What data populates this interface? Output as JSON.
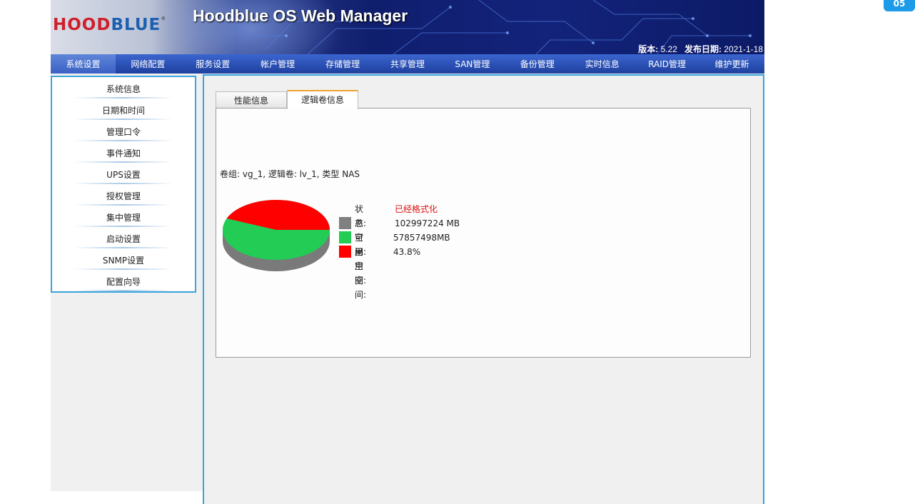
{
  "header": {
    "logo_left": "HOOD",
    "logo_right": "BLUE",
    "title": "Hoodblue OS Web Manager",
    "version_label": "版本:",
    "version": "5.22",
    "release_label": "发布日期:",
    "release_date": "2021-1-18"
  },
  "nav": {
    "items": [
      "系统设置",
      "网络配置",
      "服务设置",
      "帐户管理",
      "存储管理",
      "共享管理",
      "SAN管理",
      "备份管理",
      "实时信息",
      "RAID管理",
      "维护更新"
    ],
    "active": "系统设置"
  },
  "sidebar": {
    "items": [
      "系统信息",
      "日期和时间",
      "管理口令",
      "事件通知",
      "UPS设置",
      "授权管理",
      "集中管理",
      "启动设置",
      "SNMP设置",
      "配置向导"
    ]
  },
  "tabs": {
    "perf": "性能信息",
    "lv": "逻辑卷信息",
    "active": "逻辑卷信息"
  },
  "volume": {
    "info": "卷组: vg_1, 逻辑卷: lv_1, 类型 NAS",
    "status_label": "状态:",
    "status_value": "已经格式化",
    "total_label": "总空间:",
    "total_value": "102997224 MB",
    "free_label": "可用空间:",
    "free_value": "57857498MB",
    "used_label": "已用空间:",
    "used_value": "43.8%",
    "used_fraction": 0.438
  },
  "colors": {
    "total": "#808080",
    "free": "#22cc55",
    "used": "#ff0000",
    "status": "#e01010",
    "accent": "#3aa4dc"
  },
  "corner_badge": "05"
}
